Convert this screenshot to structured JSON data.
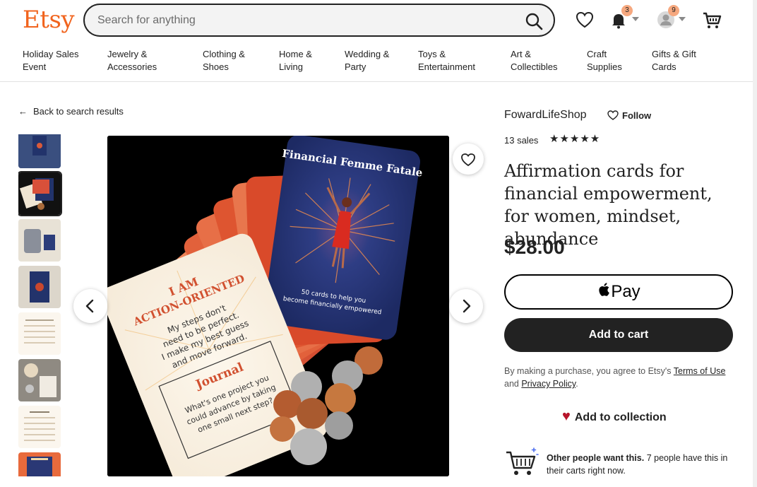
{
  "header": {
    "logo": "Etsy",
    "search_placeholder": "Search for anything",
    "notifications_count": "3",
    "account_count": "9"
  },
  "nav": [
    {
      "line1": "Holiday Sales",
      "line2": "Event"
    },
    {
      "line1": "Jewelry &",
      "line2": "Accessories"
    },
    {
      "line1": "Clothing &",
      "line2": "Shoes"
    },
    {
      "line1": "Home &",
      "line2": "Living"
    },
    {
      "line1": "Wedding &",
      "line2": "Party"
    },
    {
      "line1": "Toys &",
      "line2": "Entertainment"
    },
    {
      "line1": "Art &",
      "line2": "Collectibles"
    },
    {
      "line1": "Craft",
      "line2": "Supplies"
    },
    {
      "line1": "Gifts & Gift",
      "line2": "Cards"
    }
  ],
  "back_link": "Back to search results",
  "image": {
    "card_front_title": "Financial Femme Fatale",
    "card_front_sub1": "50 cards to help you",
    "card_front_sub2": "become financially empowered",
    "card_white_l1": "I AM",
    "card_white_l2": "ACTION-ORIENTED",
    "card_white_body": [
      "My steps don't",
      "need to be perfect.",
      "I make my best guess",
      "and move forward."
    ],
    "journal_label": "Journal",
    "journal_body": [
      "What's one project you",
      "could advance by taking",
      "one small next step?"
    ]
  },
  "listing": {
    "shop_name": "FowardLifeShop",
    "follow_label": "Follow",
    "sales": "13 sales",
    "stars": "★★★★★",
    "title": "Affirmation cards for financial empowerment, for women, mindset, abundance",
    "price": "$28.00",
    "applepay_label": "Pay",
    "add_to_cart": "Add to cart",
    "terms_prefix": "By making a purchase, you agree to Etsy's ",
    "terms_link": "Terms of Use",
    "terms_and": " and ",
    "privacy_link": "Privacy Policy",
    "terms_suffix": ".",
    "add_to_collection": "Add to collection",
    "other_people_bold": "Other people want this.",
    "other_people_rest": " 7 people have this in their carts right now."
  },
  "colors": {
    "brand": "#f1641e",
    "button_dark": "#222222",
    "badge": "#f6a87f",
    "heart": "#b7152b"
  }
}
